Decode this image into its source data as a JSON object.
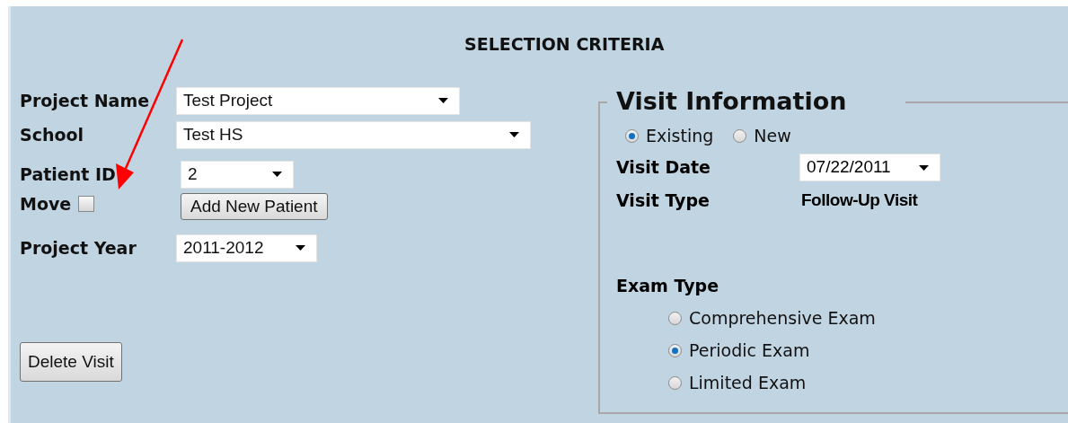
{
  "title": "SELECTION CRITERIA",
  "project_name": {
    "label": "Project Name",
    "value": "Test Project"
  },
  "school": {
    "label": "School",
    "value": "Test HS"
  },
  "patient_id": {
    "label": "Patient ID",
    "value": "2"
  },
  "move": {
    "label": "Move",
    "checked": false
  },
  "add_patient_button": "Add New Patient",
  "project_year": {
    "label": "Project Year",
    "value": "2011-2012"
  },
  "delete_button": "Delete Visit",
  "visit_information": {
    "title": "Visit Information",
    "visit_status": [
      {
        "label": "Existing",
        "selected": true
      },
      {
        "label": "New",
        "selected": false
      }
    ],
    "visit_date": {
      "label": "Visit Date",
      "value": "07/22/2011"
    },
    "visit_type": {
      "label": "Visit Type",
      "value": "Follow-Up Visit"
    },
    "exam_type": {
      "label": "Exam Type",
      "options": [
        {
          "label": "Comprehensive Exam",
          "selected": false
        },
        {
          "label": "Periodic Exam",
          "selected": true
        },
        {
          "label": "Limited Exam",
          "selected": false
        }
      ]
    }
  }
}
